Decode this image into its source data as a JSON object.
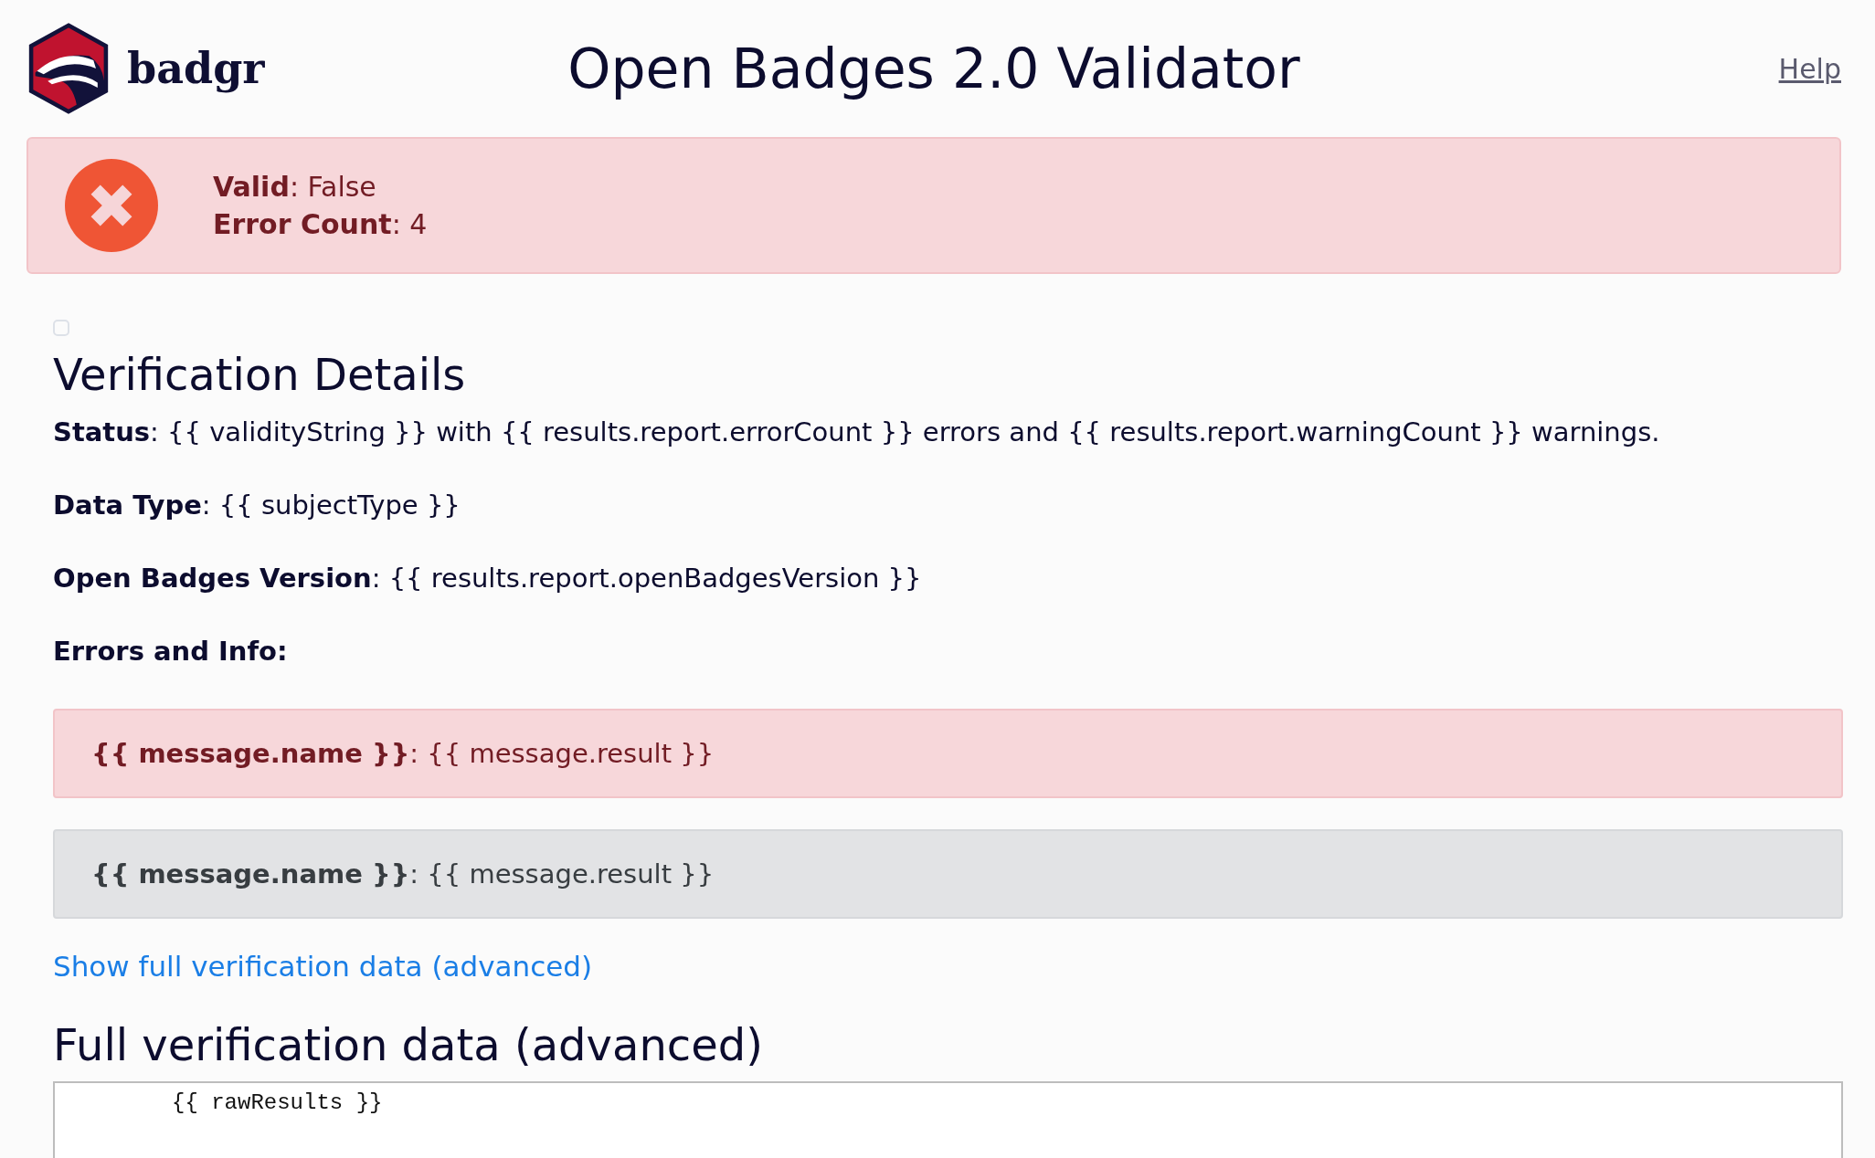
{
  "header": {
    "logo_text": "badgr",
    "title": "Open Badges 2.0 Validator",
    "help_link": "Help"
  },
  "summary": {
    "valid": false,
    "lines": [
      "**Valid**: False",
      "**Error Count**: 4"
    ]
  },
  "details": {
    "toggle_checked": false,
    "heading": "Verification Details",
    "fields": [
      "**Status**: {{ validityString }} with {{ results.report.errorCount }} errors and {{ results.report.warningCount }} warnings.",
      "**Data Type**: {{ subjectType }}",
      "**Open Badges Version**: {{ results.report.openBadgesVersion }}"
    ],
    "messages_heading": "Errors and Info:",
    "messages": [
      {
        "kind": "error",
        "text": "**{{ message.name }}**: {{ message.result }}"
      },
      {
        "kind": "info",
        "text": "**{{ message.name }}**: {{ message.result }}"
      }
    ],
    "show_link": "Show full verification data (advanced)",
    "raw_heading": "Full verification data (advanced)",
    "raw": "{{ rawResults }}"
  }
}
